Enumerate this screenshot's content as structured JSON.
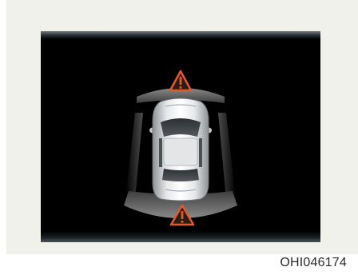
{
  "caption": "OHI046174",
  "colors": {
    "panel_bg": "#f0f1ea",
    "screen_bg": "#000000",
    "warning_orange": "#e5582a",
    "zone_gray": "#6b6b6b"
  },
  "icons": {
    "front_warning": "warning-triangle-icon",
    "rear_warning": "warning-triangle-icon"
  }
}
